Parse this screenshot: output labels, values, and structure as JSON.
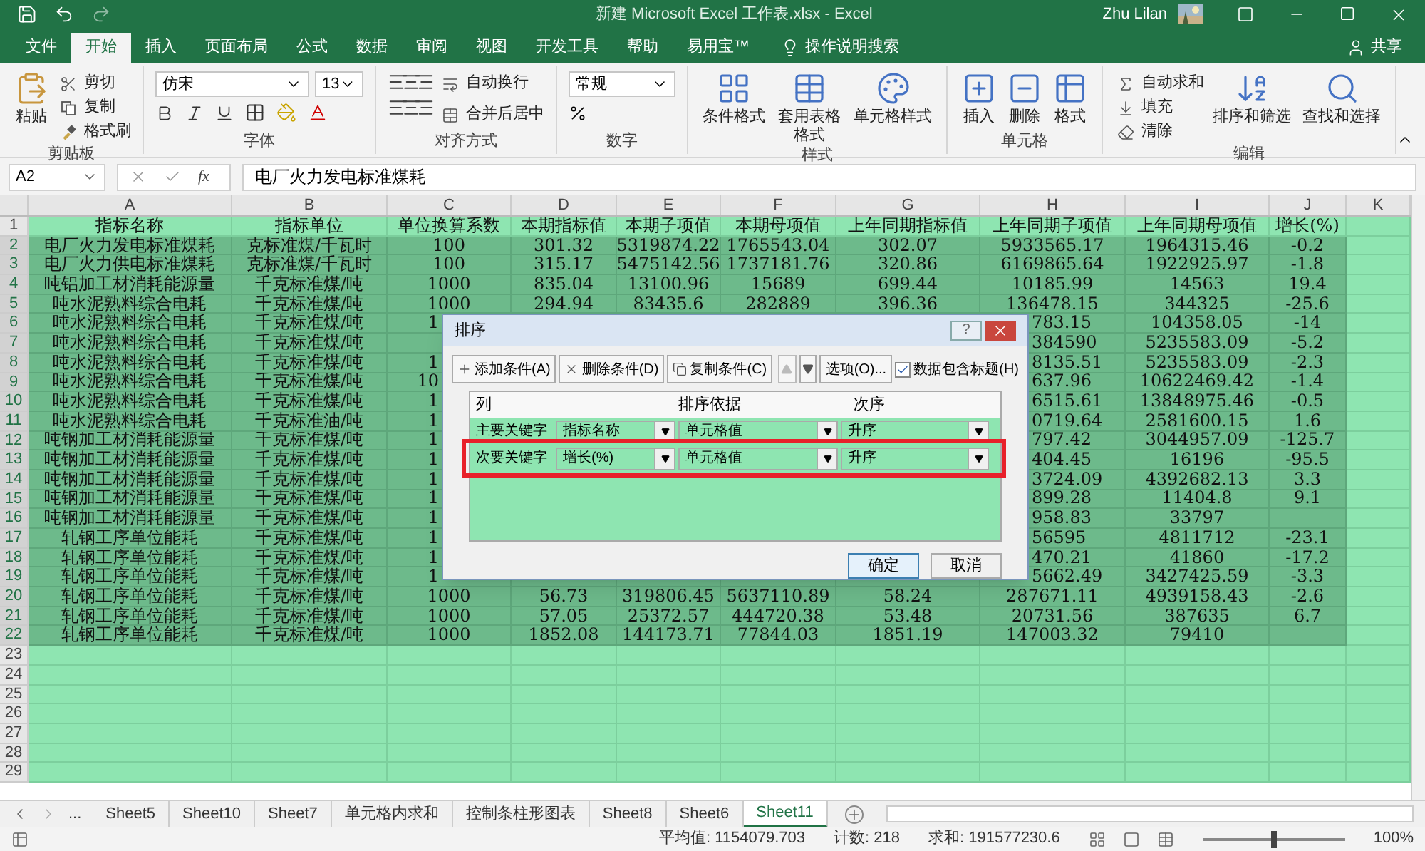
{
  "title_bar": {
    "title": "新建 Microsoft Excel 工作表.xlsx  -  Excel",
    "user": "Zhu Lilan"
  },
  "tabs": [
    {
      "label": "文件",
      "selected": false
    },
    {
      "label": "开始",
      "selected": true
    },
    {
      "label": "插入",
      "selected": false
    },
    {
      "label": "页面布局",
      "selected": false
    },
    {
      "label": "公式",
      "selected": false
    },
    {
      "label": "数据",
      "selected": false
    },
    {
      "label": "审阅",
      "selected": false
    },
    {
      "label": "视图",
      "selected": false
    },
    {
      "label": "开发工具",
      "selected": false
    },
    {
      "label": "帮助",
      "selected": false
    },
    {
      "label": "易用宝™",
      "selected": false
    }
  ],
  "tell_me": "操作说明搜索",
  "share": "共享",
  "ribbon": {
    "groups": [
      {
        "kind": "clipboard",
        "label": "剪贴板",
        "paste": "粘贴",
        "items": [
          "剪切",
          "复制",
          "格式刷"
        ]
      },
      {
        "kind": "font",
        "label": "字体",
        "font": "仿宋",
        "size": "13"
      },
      {
        "kind": "alignment",
        "label": "对齐方式",
        "items": [
          "自动换行",
          "合并后居中"
        ]
      },
      {
        "kind": "number",
        "label": "数字",
        "format": "常规"
      },
      {
        "kind": "styles",
        "label": "样式",
        "items": [
          "条件格式",
          "套用表格格式",
          "单元格样式"
        ]
      },
      {
        "kind": "cells",
        "label": "单元格",
        "items": [
          "插入",
          "删除",
          "格式"
        ]
      },
      {
        "kind": "editing",
        "label": "编辑",
        "items": [
          "自动求和",
          "填充",
          "清除"
        ],
        "big": [
          "排序和筛选",
          "查找和选择"
        ]
      }
    ]
  },
  "formula_bar": {
    "name_box": "A2",
    "fx": "fx",
    "content": "电厂火力发电标准煤耗"
  },
  "sheet": {
    "columns": [
      "A",
      "B",
      "C",
      "D",
      "E",
      "F",
      "G",
      "H",
      "I",
      "J",
      "K"
    ],
    "rows": [
      {
        "number": "1",
        "selected": false,
        "cells": [
          "指标名称",
          "指标单位",
          "单位换算系数",
          "本期指标值",
          "本期子项值",
          "本期母项值",
          "上年同期指标值",
          "上年同期子项值",
          "上年同期母项值",
          "增长(%)"
        ]
      },
      {
        "number": "2",
        "selected": true,
        "cells": [
          "电厂火力发电标准煤耗",
          "克标准煤/千瓦时",
          "100",
          "301.32",
          "5319874.22",
          "1765543.04",
          "302.07",
          "5933565.17",
          "1964315.46",
          "-0.2"
        ]
      },
      {
        "number": "3",
        "selected": true,
        "cells": [
          "电厂火力供电标准煤耗",
          "克标准煤/千瓦时",
          "100",
          "315.17",
          "5475142.56",
          "1737181.76",
          "320.86",
          "6169865.64",
          "1922925.97",
          "-1.8"
        ]
      },
      {
        "number": "4",
        "selected": true,
        "cells": [
          "吨铝加工材消耗能源量",
          "千克标准煤/吨",
          "1000",
          "835.04",
          "13100.96",
          "15689",
          "699.44",
          "10185.99",
          "14563",
          "19.4"
        ]
      },
      {
        "number": "5",
        "selected": true,
        "cells": [
          "吨水泥熟料综合电耗",
          "千克标准煤/吨",
          "1000",
          "294.94",
          "83435.6",
          "282889",
          "396.36",
          "136478.15",
          "344325",
          "-25.6"
        ]
      },
      {
        "number": "6",
        "selected": true,
        "cells": [
          "吨水泥熟料综合电耗",
          "千克标准煤/吨",
          {
            "text": "1",
            "kind": "cut-right"
          },
          null,
          null,
          null,
          null,
          {
            "text": "783.15",
            "kind": "cut-left"
          },
          "104358.05",
          "-14"
        ]
      },
      {
        "number": "7",
        "selected": true,
        "cells": [
          "吨水泥熟料综合电耗",
          "千克标准煤/吨",
          null,
          null,
          null,
          null,
          null,
          {
            "text": "384590",
            "kind": "cut-left"
          },
          "5235583.09",
          "-5.2"
        ]
      },
      {
        "number": "8",
        "selected": true,
        "cells": [
          "吨水泥熟料综合电耗",
          "千克标准煤/吨",
          {
            "text": "1",
            "kind": "cut-right"
          },
          null,
          null,
          null,
          null,
          {
            "text": "8135.51",
            "kind": "cut-left"
          },
          "5235583.09",
          "-2.3"
        ]
      },
      {
        "number": "9",
        "selected": true,
        "cells": [
          "吨水泥熟料综合电耗",
          "千克标准煤/吨",
          {
            "text": "10",
            "kind": "cut-right"
          },
          null,
          null,
          null,
          null,
          {
            "text": "637.96",
            "kind": "cut-left"
          },
          "10622469.42",
          "-1.4"
        ]
      },
      {
        "number": "10",
        "selected": true,
        "cells": [
          "吨水泥熟料综合电耗",
          "千克标准煤/吨",
          {
            "text": "1",
            "kind": "cut-right"
          },
          null,
          null,
          null,
          null,
          {
            "text": "6515.61",
            "kind": "cut-left"
          },
          "13848975.46",
          "-0.5"
        ]
      },
      {
        "number": "11",
        "selected": true,
        "cells": [
          "吨水泥熟料综合电耗",
          "千克标准油/吨",
          {
            "text": "1",
            "kind": "cut-right"
          },
          null,
          null,
          null,
          null,
          {
            "text": "0719.64",
            "kind": "cut-left"
          },
          "2581600.15",
          "1.6"
        ]
      },
      {
        "number": "12",
        "selected": true,
        "cells": [
          "吨钢加工材消耗能源量",
          "千克标准煤/吨",
          {
            "text": "1",
            "kind": "cut-right"
          },
          null,
          null,
          null,
          null,
          {
            "text": "797.42",
            "kind": "cut-left"
          },
          "3044957.09",
          "-125.7"
        ]
      },
      {
        "number": "13",
        "selected": true,
        "cells": [
          "吨钢加工材消耗能源量",
          "千克标准煤/吨",
          {
            "text": "1",
            "kind": "cut-right"
          },
          null,
          null,
          null,
          null,
          {
            "text": "404.45",
            "kind": "cut-left"
          },
          "16196",
          "-95.5"
        ]
      },
      {
        "number": "14",
        "selected": true,
        "cells": [
          "吨钢加工材消耗能源量",
          "千克标准煤/吨",
          {
            "text": "1",
            "kind": "cut-right"
          },
          null,
          null,
          null,
          null,
          {
            "text": "3724.09",
            "kind": "cut-left"
          },
          "4392682.13",
          "3.3"
        ]
      },
      {
        "number": "15",
        "selected": true,
        "cells": [
          "吨钢加工材消耗能源量",
          "千克标准煤/吨",
          {
            "text": "1",
            "kind": "cut-right"
          },
          null,
          null,
          null,
          null,
          {
            "text": "899.28",
            "kind": "cut-left"
          },
          "11404.8",
          "9.1"
        ]
      },
      {
        "number": "16",
        "selected": true,
        "cells": [
          "吨钢加工材消耗能源量",
          "千克标准煤/吨",
          {
            "text": "1",
            "kind": "cut-right"
          },
          null,
          null,
          null,
          null,
          {
            "text": "958.83",
            "kind": "cut-left"
          },
          "33797",
          null
        ]
      },
      {
        "number": "17",
        "selected": true,
        "cells": [
          "轧钢工序单位能耗",
          "千克标准煤/吨",
          {
            "text": "1",
            "kind": "cut-right"
          },
          null,
          null,
          null,
          null,
          {
            "text": "56595",
            "kind": "cut-left"
          },
          "4811712",
          "-23.1"
        ]
      },
      {
        "number": "18",
        "selected": true,
        "cells": [
          "轧钢工序单位能耗",
          "千克标准煤/吨",
          {
            "text": "1",
            "kind": "cut-right"
          },
          null,
          null,
          null,
          null,
          {
            "text": "470.21",
            "kind": "cut-left"
          },
          "41860",
          "-17.2"
        ]
      },
      {
        "number": "19",
        "selected": true,
        "cells": [
          "轧钢工序单位能耗",
          "千克标准煤/吨",
          {
            "text": "1",
            "kind": "cut-right"
          },
          null,
          null,
          null,
          null,
          {
            "text": "5662.49",
            "kind": "cut-left"
          },
          "3427425.59",
          "-3.3"
        ]
      },
      {
        "number": "20",
        "selected": true,
        "cells": [
          "轧钢工序单位能耗",
          "千克标准煤/吨",
          "1000",
          "56.73",
          "319806.45",
          "5637110.89",
          "58.24",
          "287671.11",
          "4939158.43",
          "-2.6"
        ]
      },
      {
        "number": "21",
        "selected": true,
        "cells": [
          "轧钢工序单位能耗",
          "千克标准煤/吨",
          "1000",
          "57.05",
          "25372.57",
          "444720.38",
          "53.48",
          "20731.56",
          "387635",
          "6.7"
        ]
      },
      {
        "number": "22",
        "selected": true,
        "cells": [
          "轧钢工序单位能耗",
          "千克标准煤/吨",
          "1000",
          "1852.08",
          "144173.71",
          "77844.03",
          "1851.19",
          "147003.32",
          "79410",
          null
        ]
      },
      {
        "number": "23",
        "selected": false
      },
      {
        "number": "24",
        "selected": false
      },
      {
        "number": "25",
        "selected": false
      },
      {
        "number": "26",
        "selected": false
      },
      {
        "number": "27",
        "selected": false
      },
      {
        "number": "28",
        "selected": false
      },
      {
        "number": "29",
        "selected": false
      }
    ]
  },
  "dialog": {
    "title": "排序",
    "help": "?",
    "buttons": [
      "添加条件(A)",
      "删除条件(D)",
      "复制条件(C)"
    ],
    "options": "选项(O)...",
    "has_headers": {
      "label": "数据包含标题(H)",
      "checked": true
    },
    "headers": [
      "列",
      "排序依据",
      "次序"
    ],
    "levels": [
      {
        "label": "主要关键字",
        "column": "指标名称",
        "sort_on": "单元格值",
        "order": "升序",
        "highlighted": false
      },
      {
        "label": "次要关键字",
        "column": "增长(%)",
        "sort_on": "单元格值",
        "order": "升序",
        "highlighted": true
      }
    ],
    "ok": "确定",
    "cancel": "取消"
  },
  "sheet_tabs": {
    "more": "...",
    "tabs": [
      {
        "label": "Sheet5",
        "selected": false
      },
      {
        "label": "Sheet10",
        "selected": false
      },
      {
        "label": "Sheet7",
        "selected": false
      },
      {
        "label": "单元格内求和",
        "selected": false
      },
      {
        "label": "控制条柱形图表",
        "selected": false
      },
      {
        "label": "Sheet8",
        "selected": false
      },
      {
        "label": "Sheet6",
        "selected": false
      },
      {
        "label": "Sheet11",
        "selected": true
      }
    ]
  },
  "status_bar": {
    "average": "平均值: 1154079.703",
    "count": "计数: 218",
    "sum": "求和: 191577230.6",
    "zoom": "100%",
    "zoom_slider": {
      "level": 0.5
    }
  }
}
